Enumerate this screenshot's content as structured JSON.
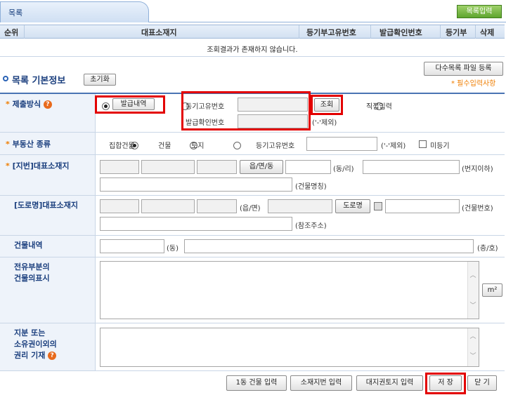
{
  "tab": {
    "title": "목록",
    "register_button": "목록입력"
  },
  "list": {
    "columns": [
      "순위",
      "대표소재지",
      "등기부고유번호",
      "발급확인번호",
      "등기부",
      "삭제"
    ],
    "empty_message": "조회결과가 존재하지 않습니다."
  },
  "section": {
    "title": "목록 기본정보",
    "reset_button": "초기화",
    "multi_upload_button": "다수목록 파일 등록",
    "required_note": "* 필수입력사항"
  },
  "fields": {
    "submit_method": {
      "label": "제출방식",
      "option_issue": "발급내역",
      "reg_no_label": "등기고유번호",
      "issue_no_label": "발급확인번호",
      "lookup_button": "조회",
      "dash_note": "('-'제외)",
      "option_direct": "직접입력"
    },
    "property_type": {
      "label": "부동산 종류",
      "options": [
        "집합건물",
        "건물",
        "토지"
      ],
      "reg_no_label": "등기고유번호",
      "dash_note": "('-'제외)",
      "unregistered": "미등기"
    },
    "lot_address": {
      "label": "[지번]대표소재지",
      "lookup_button": "읍/면/동",
      "suffix_dongri": "(동/리)",
      "suffix_lotno": "(번지이하)",
      "suffix_building": "(건물명칭)"
    },
    "road_address": {
      "label": "[도로명]대표소재지",
      "suffix_eupmyeon": "(읍/면)",
      "road_button": "도로명",
      "suffix_bldgno": "(건물번호)",
      "suffix_ref": "(참조주소)"
    },
    "building_detail": {
      "label": "건물내역",
      "suffix_dong": "(동)",
      "suffix_floor": "(층/호)"
    },
    "exclusive_part": {
      "label_line1": "전유부분의",
      "label_line2": "건물의표시",
      "unit_button": "m²"
    },
    "share": {
      "label_line1": "지분 또는",
      "label_line2": "소유권이외의",
      "label_line3": "권리 기재"
    }
  },
  "bottom_buttons": {
    "building_input": "1동 건물 입력",
    "lot_input": "소재지번 입력",
    "land_right_input": "대지권토지 입력",
    "save": "저 장",
    "close": "닫 기"
  },
  "icons": {
    "help": "help-icon",
    "checkbox": "checkbox-icon"
  },
  "colors": {
    "accent": "#1b3f7e",
    "required": "#ef7d00",
    "highlight": "#e30000",
    "green": "#5ea52e"
  }
}
